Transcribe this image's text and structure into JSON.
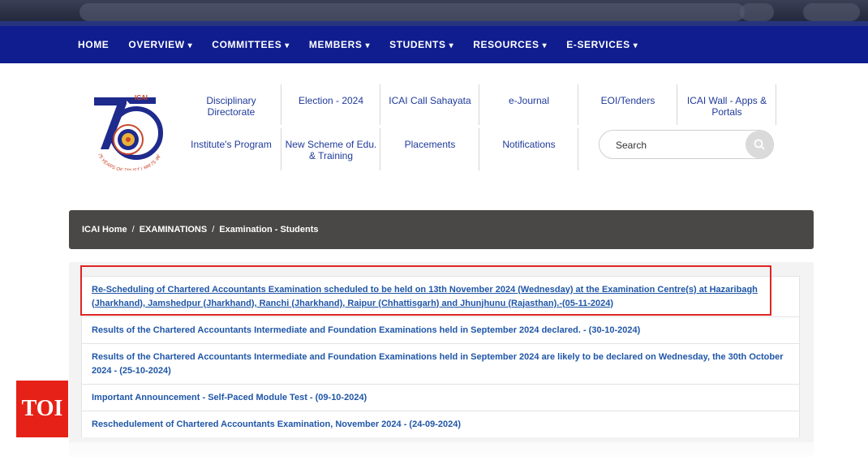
{
  "nav": {
    "items": [
      {
        "label": "HOME",
        "caret": ""
      },
      {
        "label": "OVERVIEW",
        "caret": "▾"
      },
      {
        "label": "COMMITTEES",
        "caret": "▾"
      },
      {
        "label": "MEMBERS",
        "caret": "▾"
      },
      {
        "label": "STUDENTS",
        "caret": "▾"
      },
      {
        "label": "RESOURCES",
        "caret": "▾"
      },
      {
        "label": "E-SERVICES",
        "caret": "▾"
      }
    ]
  },
  "logo": {
    "label": "ICAI",
    "number": "75",
    "tagline": "75 YEARS OF TRUST | भव्य 75 वर्ष"
  },
  "header_links": {
    "disciplinary": "Disciplinary Directorate",
    "election": "Election - 2024",
    "sahayata": "ICAI Call Sahayata",
    "ejournal": "e-Journal",
    "eoi": "EOI/Tenders",
    "wall": "ICAI Wall - Apps & Portals",
    "institute_program": "Institute's Program",
    "new_scheme": "New Scheme of Edu. & Training",
    "placements": "Placements",
    "notifications": "Notifications"
  },
  "search": {
    "placeholder": "Search"
  },
  "breadcrumb": {
    "home": "ICAI Home",
    "sep": "/",
    "section": "EXAMINATIONS",
    "current": "Examination - Students"
  },
  "announcements": [
    "Re-Scheduling of Chartered Accountants Examination scheduled to be held on 13th November 2024 (Wednesday) at the Examination Centre(s) at Hazaribagh (Jharkhand), Jamshedpur (Jharkhand), Ranchi (Jharkhand), Raipur (Chhattisgarh) and Jhunjhunu (Rajasthan).-(05-11-2024)",
    "Results of the Chartered Accountants Intermediate and Foundation Examinations held in September 2024 declared. - (30-10-2024)",
    "Results of the Chartered Accountants Intermediate and Foundation Examinations held in September 2024 are likely to be declared on Wednesday, the 30th October 2024 - (25-10-2024)",
    "Important Announcement - Self-Paced Module Test - (09-10-2024)",
    "Reschedulement of Chartered Accountants Examination, November 2024 - (24-09-2024)"
  ],
  "watermark": {
    "label": "TOI"
  },
  "colors": {
    "nav_bg": "#0f1d8f",
    "link": "#1f56a8",
    "highlight": "#e02424",
    "breadcrumb_bg": "#4a4847",
    "toi_bg": "#e62117"
  }
}
